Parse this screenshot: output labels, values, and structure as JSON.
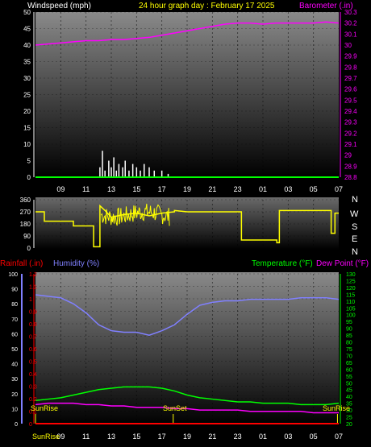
{
  "header": {
    "windspeed_label": "Windspeed (mph)",
    "title": "24 hour graph day : February 17 2025",
    "barometer_label": "Barometer (.in)"
  },
  "mid": {
    "compass": [
      "N",
      "W",
      "S",
      "E",
      "N"
    ]
  },
  "bottom": {
    "rainfall_label": "Rainfall (.in)",
    "humidity_label": "Humidity (%)",
    "temperature_label": "Temperature (°F)",
    "dewpoint_label": "Dew Point (°F)",
    "sunrise_label": "SunRise",
    "sunset_label": "SunSet"
  },
  "colors": {
    "windspeed": "#ffffff",
    "barometer": "#ff00ff",
    "winddir": "#ffff00",
    "humidity": "#8080ff",
    "temperature": "#00ff00",
    "dewpoint": "#ff00ff",
    "rainfall": "#ff0000",
    "title": "#ffff00"
  },
  "chart_data": [
    {
      "type": "line",
      "name": "windspeed-barometer",
      "x_ticks": [
        "09",
        "11",
        "13",
        "15",
        "17",
        "19",
        "21",
        "23",
        "01",
        "03",
        "05",
        "07"
      ],
      "y_left_ticks": [
        "0",
        "5",
        "10",
        "15",
        "20",
        "25",
        "30",
        "35",
        "40",
        "45",
        "50"
      ],
      "y_left_range": [
        0,
        50
      ],
      "y_right_ticks": [
        "28.8",
        "28.9",
        "29",
        "29.1",
        "29.2",
        "29.3",
        "29.4",
        "29.5",
        "29.6",
        "29.7",
        "29.8",
        "29.9",
        "30",
        "30.1",
        "30.2",
        "30.3"
      ],
      "y_right_range": [
        28.8,
        30.3
      ],
      "x_range_hours": [
        7,
        31
      ],
      "series": [
        {
          "name": "Barometer",
          "axis": "right",
          "x": [
            7,
            8,
            9,
            10,
            11,
            12,
            13,
            14,
            15,
            16,
            17,
            18,
            19,
            20,
            21,
            22,
            23,
            24,
            25,
            26,
            27,
            28,
            29,
            30,
            31
          ],
          "y": [
            30.0,
            30.01,
            30.02,
            30.03,
            30.04,
            30.04,
            30.05,
            30.05,
            30.06,
            30.07,
            30.09,
            30.11,
            30.13,
            30.15,
            30.17,
            30.19,
            30.2,
            30.2,
            30.19,
            30.2,
            30.2,
            30.2,
            30.2,
            30.21,
            30.2
          ]
        },
        {
          "name": "Windspeed",
          "axis": "left",
          "type": "bar",
          "x": [
            12.1,
            12.3,
            12.5,
            12.8,
            13.0,
            13.2,
            13.4,
            13.6,
            13.9,
            14.1,
            14.4,
            14.7,
            15.0,
            15.3,
            15.6,
            16.0,
            16.4,
            17.0,
            17.5
          ],
          "y": [
            3,
            8,
            2,
            5,
            3,
            6,
            2,
            4,
            3,
            5,
            2,
            4,
            3,
            2,
            4,
            3,
            2,
            2,
            1
          ]
        }
      ]
    },
    {
      "type": "line",
      "name": "wind-direction",
      "x_range_hours": [
        7,
        31
      ],
      "y_ticks": [
        "360",
        "270",
        "180",
        "90",
        "0"
      ],
      "y_range": [
        0,
        360
      ],
      "series": [
        {
          "name": "Wind Direction",
          "x": [
            7,
            7.7,
            7.7,
            10,
            10,
            11.6,
            11.6,
            12.1,
            12.1,
            12.5,
            13,
            14,
            15,
            16,
            17,
            18,
            18,
            19,
            20,
            22,
            23.3,
            23.3,
            26.1,
            26.1,
            26.3,
            26.3,
            28.8,
            28.8,
            30.4,
            30.4,
            30.7,
            30.7,
            31
          ],
          "y": [
            270,
            270,
            200,
            200,
            165,
            165,
            10,
            10,
            315,
            280,
            230,
            250,
            260,
            240,
            260,
            270,
            280,
            270,
            270,
            270,
            270,
            60,
            60,
            40,
            40,
            280,
            280,
            280,
            280,
            110,
            110,
            260,
            260
          ]
        }
      ]
    },
    {
      "type": "line",
      "name": "humidity-temperature",
      "x_range_hours": [
        7,
        31
      ],
      "y_left_ticks": [
        "0",
        "10",
        "20",
        "30",
        "40",
        "50",
        "60",
        "70",
        "80",
        "90",
        "100"
      ],
      "y_left_range": [
        0,
        100
      ],
      "y_rain_ticks": [
        "0",
        "0.1",
        "0.2",
        "0.3",
        "0.4",
        "0.5",
        "0.6",
        "0.7",
        "0.8",
        "0.9",
        "1",
        "1.1",
        "1.2"
      ],
      "y_rain_range": [
        0,
        1.2
      ],
      "y_right_ticks": [
        "20",
        "25",
        "30",
        "35",
        "40",
        "45",
        "50",
        "55",
        "60",
        "65",
        "70",
        "75",
        "80",
        "85",
        "90",
        "95",
        "100",
        "105",
        "110",
        "115",
        "120",
        "125",
        "130"
      ],
      "y_right_range": [
        20,
        130
      ],
      "series": [
        {
          "name": "Humidity",
          "axis": "left",
          "x": [
            7,
            8,
            9,
            10,
            11,
            12,
            13,
            14,
            15,
            16,
            17,
            18,
            19,
            20,
            21,
            22,
            23,
            24,
            25,
            26,
            27,
            28,
            29,
            30,
            31
          ],
          "y": [
            86,
            85,
            84,
            80,
            74,
            66,
            62,
            61,
            61,
            59,
            62,
            66,
            73,
            79,
            81,
            82,
            82,
            83,
            83,
            83,
            83,
            84,
            84,
            84,
            83
          ]
        },
        {
          "name": "Temperature",
          "axis": "right",
          "x": [
            7,
            8,
            9,
            10,
            11,
            12,
            13,
            14,
            15,
            16,
            17,
            18,
            19,
            20,
            21,
            22,
            23,
            24,
            25,
            26,
            27,
            28,
            29,
            30,
            31
          ],
          "y": [
            37,
            38,
            39,
            41,
            43,
            45,
            46,
            47,
            47,
            47,
            46,
            44,
            41,
            39,
            38,
            37,
            36,
            36,
            35,
            35,
            35,
            34,
            34,
            34,
            35
          ]
        },
        {
          "name": "Dew Point",
          "axis": "right",
          "x": [
            7,
            8,
            9,
            10,
            11,
            12,
            13,
            14,
            15,
            16,
            17,
            18,
            19,
            20,
            21,
            22,
            23,
            24,
            25,
            26,
            27,
            28,
            29,
            30,
            31
          ],
          "y": [
            34,
            35,
            35,
            35,
            34,
            34,
            33,
            33,
            32,
            32,
            32,
            31,
            31,
            30,
            30,
            30,
            30,
            29,
            29,
            29,
            29,
            29,
            28,
            28,
            28
          ]
        },
        {
          "name": "Rainfall",
          "axis": "rain",
          "x": [
            7,
            31
          ],
          "y": [
            0,
            0
          ]
        }
      ],
      "sunrise_hour": 7,
      "sunset_hour": 17.9
    }
  ]
}
